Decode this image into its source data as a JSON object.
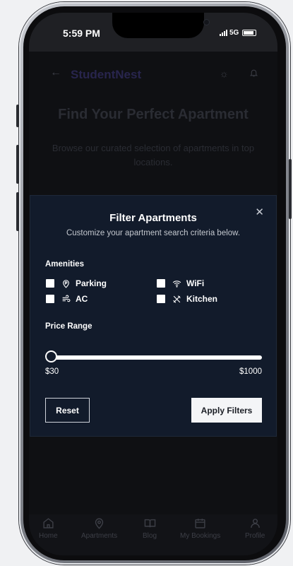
{
  "status_bar": {
    "time": "5:59 PM",
    "network": "5G"
  },
  "header": {
    "app_name": "StudentNest",
    "back_icon": "arrow-left-icon",
    "theme_icon": "sun-icon",
    "notification_icon": "bell-icon"
  },
  "hero": {
    "title": "Find Your Perfect Apartment",
    "subtitle": "Browse our curated selection of apartments in top locations."
  },
  "filter_modal": {
    "title": "Filter Apartments",
    "subtitle": "Customize your apartment search criteria below.",
    "close_icon": "close-icon",
    "amenities_label": "Amenities",
    "amenities": [
      {
        "label": "Parking",
        "icon": "parking-icon",
        "checked": false
      },
      {
        "label": "WiFi",
        "icon": "wifi-icon",
        "checked": false
      },
      {
        "label": "AC",
        "icon": "wind-icon",
        "checked": false
      },
      {
        "label": "Kitchen",
        "icon": "utensils-icon",
        "checked": false
      }
    ],
    "price_range_label": "Price Range",
    "price_min": "$30",
    "price_max": "$1000",
    "reset_label": "Reset",
    "apply_label": "Apply Filters"
  },
  "tab_bar": {
    "items": [
      {
        "label": "Home",
        "icon": "home-icon"
      },
      {
        "label": "Apartments",
        "icon": "map-pin-icon"
      },
      {
        "label": "Blog",
        "icon": "book-icon"
      },
      {
        "label": "My Bookings",
        "icon": "calendar-icon"
      },
      {
        "label": "Profile",
        "icon": "user-icon"
      }
    ]
  },
  "colors": {
    "modal_background": "#121b2b",
    "overlay": "#0f1013",
    "brand": "#28254d"
  }
}
